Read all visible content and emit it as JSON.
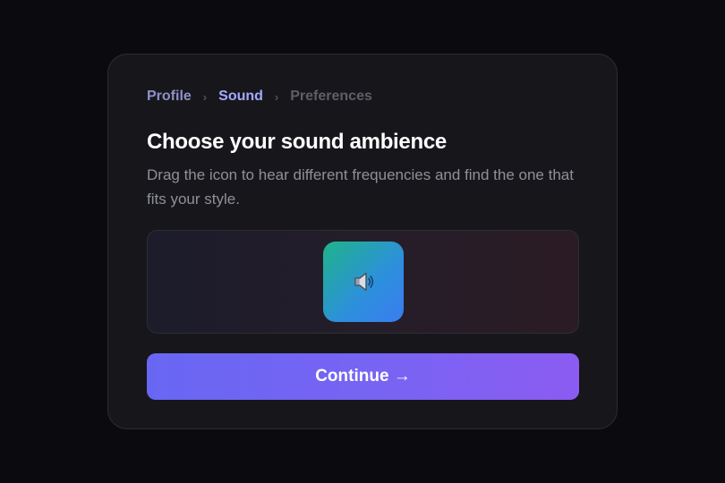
{
  "breadcrumb": {
    "steps": [
      {
        "label": "Profile",
        "state": "done"
      },
      {
        "label": "Sound",
        "state": "active"
      },
      {
        "label": "Preferences",
        "state": "pending"
      }
    ],
    "separator": "›"
  },
  "heading": {
    "title": "Choose your sound ambience",
    "subtitle": "Drag the icon to hear different frequencies and find the one that fits your style."
  },
  "sound_picker": {
    "handle_icon": "speaker-icon"
  },
  "actions": {
    "continue_label": "Continue →"
  },
  "colors": {
    "background": "#0b0b0f",
    "card": "#17171b",
    "accent": "#7a63f3",
    "crumb_active": "#a5a9ff",
    "handle_gradient_start": "#1fb389",
    "handle_gradient_end": "#3b7cf0"
  }
}
